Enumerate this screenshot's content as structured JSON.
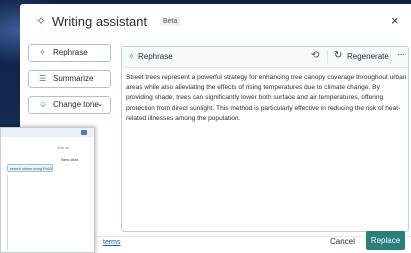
{
  "dialog": {
    "title": "Writing assistant",
    "badge": "Beta",
    "close_icon": "×"
  },
  "sidebar": {
    "items": [
      {
        "label": "Rephrase",
        "icon": "rephrase-icon"
      },
      {
        "label": "Summarize",
        "icon": "summarize-icon"
      },
      {
        "label": "Change tone",
        "icon": "tone-icon"
      }
    ]
  },
  "panel": {
    "mode_label": "Rephrase",
    "regenerate_label": "Regenerate",
    "body": "Street trees represent a powerful strategy for enhancing tree canopy coverage throughout urban areas while also alleviating the effects of rising temperatures due to climate change. By providing shade, trees can significantly lower both surface and air temperatures, offering protection from direct sunlight. This method is particularly effective in reducing the risk of heat-related illnesses among the population."
  },
  "footer": {
    "terms_prefix": "e",
    "terms_link": "terms",
    "cancel_label": "Cancel",
    "replace_label": "Replace"
  },
  "overlay": {
    "new_chat": "New chat",
    "chip": "search rubber using Flu03",
    "small_a": "Sho wi"
  },
  "colors": {
    "accent": "#2a7f7a",
    "link": "#1a5ea8",
    "panel_border": "#b9d6d3"
  }
}
